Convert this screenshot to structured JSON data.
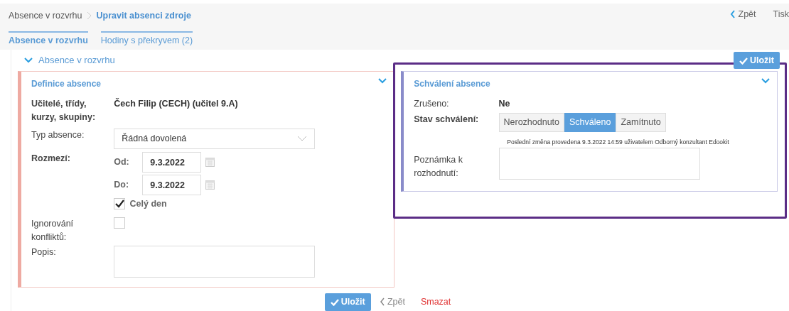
{
  "breadcrumb": [
    {
      "label": "Absence v rozvrhu",
      "current": false
    },
    {
      "label": "Upravit absenci zdroje",
      "current": true
    }
  ],
  "top_actions": {
    "back": "Zpět",
    "print": "Tisk"
  },
  "tabs": [
    {
      "label": "Absence v rozvrhu",
      "selected": true
    },
    {
      "label": "Hodiny s překryvem (2)",
      "selected": false
    }
  ],
  "section": {
    "title": "Absence v rozvrhu",
    "expanded": true,
    "save_button": "Uložit"
  },
  "definition": {
    "title": "Definice absence",
    "expanded": true,
    "teachers_label": "Učitelé, třídy, kurzy, skupiny:",
    "teachers_value": "Čech Filip (CECH)  (učitel 9.A)",
    "type_label": "Typ absence:",
    "type_value": "Řádná dovolená",
    "range_label": "Rozmezí:",
    "from_label": "Od:",
    "from_value": "9.3.2022",
    "to_label": "Do:",
    "to_value": "9.3.2022",
    "whole_day": {
      "label": "Celý den",
      "checked": true
    },
    "ignore_label": "Ignorování konfliktů:",
    "ignore_checked": false,
    "description_label": "Popis:"
  },
  "approval": {
    "title": "Schválení absence",
    "expanded": true,
    "cancelled_label": "Zrušeno:",
    "cancelled_value": "Ne",
    "state_label": "Stav schválení:",
    "states": [
      {
        "label": "Nerozhodnuto",
        "selected": false
      },
      {
        "label": "Schváleno",
        "selected": true
      },
      {
        "label": "Zamítnuto",
        "selected": false
      }
    ],
    "last_change": "Poslední změna provedena 9.3.2022 14:59 uživatelem Odborný konzultant Edookit",
    "note_label": "Poznámka k rozhodnutí:"
  },
  "footer": {
    "save": "Uložit",
    "back": "Zpět",
    "delete": "Smazat"
  },
  "highlight_frame": true
}
